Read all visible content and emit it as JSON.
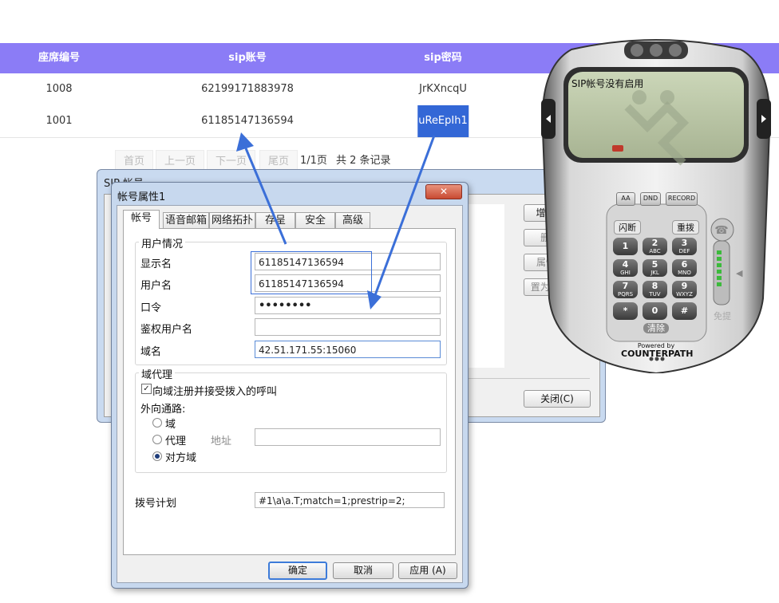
{
  "table": {
    "headers": [
      "座席编号",
      "sip账号",
      "sip密码"
    ],
    "rows": [
      {
        "seat": "1008",
        "account": "62199171883978",
        "password": "JrKXncqU"
      },
      {
        "seat": "1001",
        "account": "61185147136594",
        "password": "uReEpIh1"
      }
    ]
  },
  "pagination": {
    "first": "首页",
    "prev": "上一页",
    "next": "下一页",
    "last": "尾页",
    "page_info": "1/1页",
    "total": "共 2 条记录"
  },
  "sip_dialog": {
    "title": "SIP 帐号",
    "close": "✕",
    "add": "增加(A)...",
    "delete": "删除(R)",
    "properties": "属性(P)...",
    "set_default": "置为默认(D)",
    "close_button": "关闭(C)"
  },
  "prop_dialog": {
    "title": "帐号属性1",
    "close": "✕",
    "tabs": [
      "帐号",
      "语音邮箱",
      "网络拓扑",
      "存呈",
      "安全",
      "高级"
    ],
    "user_group": {
      "title": "用户情况",
      "display_name_label": "显示名",
      "display_name": "61185147136594",
      "username_label": "用户名",
      "username": "61185147136594",
      "password_label": "口令",
      "password": "••••••••",
      "auth_user_label": "鉴权用户名",
      "auth_user": "",
      "domain_label": "域名",
      "domain": "42.51.171.55:15060"
    },
    "proxy_group": {
      "title": "域代理",
      "register_label": "向域注册并接受拨入的呼叫",
      "register_checked": true,
      "outbound_label": "外向通路:",
      "options": [
        "域",
        "代理",
        "对方域"
      ],
      "selected": "对方域",
      "address_label": "地址",
      "address": ""
    },
    "dial_plan_label": "拨号计划",
    "dial_plan": "#1\\a\\a.T;match=1;prestrip=2;",
    "ok": "确定",
    "cancel": "取消",
    "apply": "应用 (A)"
  },
  "softphone": {
    "screen_text": "SIP帐号没有启用",
    "aa": "AA",
    "dnd": "DND",
    "record": "RECORD",
    "flash": "闪断",
    "redial": "重拨",
    "keys": [
      {
        "d": "1",
        "l": ""
      },
      {
        "d": "2",
        "l": "ABC"
      },
      {
        "d": "3",
        "l": "DEF"
      },
      {
        "d": "4",
        "l": "GHI"
      },
      {
        "d": "5",
        "l": "JKL"
      },
      {
        "d": "6",
        "l": "MNO"
      },
      {
        "d": "7",
        "l": "PQRS"
      },
      {
        "d": "8",
        "l": "TUV"
      },
      {
        "d": "9",
        "l": "WXYZ"
      },
      {
        "d": "*",
        "l": ""
      },
      {
        "d": "0",
        "l": ""
      },
      {
        "d": "#",
        "l": ""
      }
    ],
    "clear": "清除",
    "handsfree": "免提",
    "powered_by": "Powered by",
    "brand": "COUNTERPATH"
  },
  "colors": {
    "table_header": "#8b7cf6",
    "highlight": "#3367d6",
    "arrow": "#3b6fd8"
  }
}
